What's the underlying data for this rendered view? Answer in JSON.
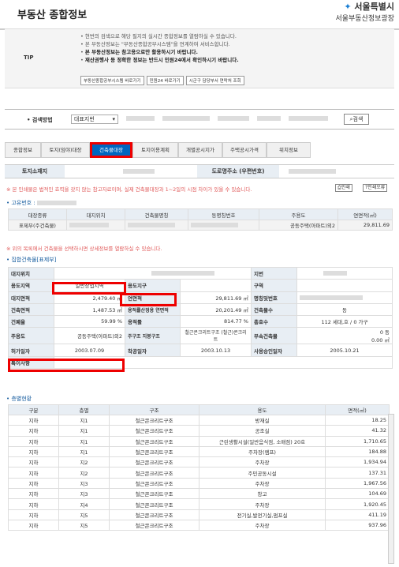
{
  "header": {
    "title": "부동산 종합정보",
    "logo_line1": "서울특별시",
    "logo_line2": "서울부동산정보광장"
  },
  "tip": {
    "label": "TIP",
    "lines": [
      "현번의 검색으로 해당 필지의 실시간 종합정보를 열람하실 수 있습니다.",
      "본 부동산정보는 \"부동산종합공부시스템\"을 연계하여 서비스합니다.",
      "본 부동산정보는 참고용으로만 활용하시기 바랍니다.",
      "재산권행사 등 정확한 정보는 반드시 민원24에서 확인하시기 바랍니다."
    ],
    "buttons": [
      "부동산종합공부시스템 바로가기",
      "민원24 바로가기",
      "시군구 담당부서 연락처 조회"
    ]
  },
  "search": {
    "label": "검색방법",
    "select_value": "대표지번",
    "button": "검색"
  },
  "tabs": [
    "종합정보",
    "토지(임야)대장",
    "건축물대장",
    "토지이용계획",
    "개별공시지가",
    "주택공시가격",
    "위치정보"
  ],
  "location": {
    "land_label": "토지소재지",
    "road_label": "도로명주소 (우편번호)"
  },
  "notice1": "※ 본 인쇄물은 법적인 효력을 갖지 않는 참고자료이며, 실제 건축물대장과 1~2일의 시점 차이가 있을 수 있습니다.",
  "print_btn": "인쇄",
  "print_err_btn": "인쇄오류",
  "unique_no_label": "고유번호 :",
  "building_list": {
    "headers": [
      "대장종류",
      "대지위치",
      "건축물명칭",
      "동명칭번호",
      "주용도",
      "연면적(㎡)"
    ],
    "row": {
      "type": "표제부(주건축물)",
      "use": "공동주택(아파트)외2",
      "area": "29,811.69"
    }
  },
  "notice2": "※ 위의 목록에서 건축물을 선택하시면 상세정보를 열람하실 수 있습니다.",
  "detail_title": "집합건축물[표제부]",
  "detail": {
    "site": "대지위치",
    "lot": "지번",
    "zone_label": "용도지역",
    "zone": "일반상업지역",
    "district_label": "용도지구",
    "area_label": "구역",
    "land_area_label": "대지면적",
    "land_area": "2,479.40 ㎡",
    "total_area_label": "연면적",
    "total_area": "29,811.69 ㎡",
    "name_label": "명칭및번호",
    "build_area_label": "건축면적",
    "build_area": "1,487.53 ㎡",
    "floor_ratio_area_label": "용적률산정용 연면적",
    "floor_ratio_area": "20,201.49 ㎡",
    "bldg_count_label": "건축물수",
    "bldg_count": "동",
    "coverage_label": "건폐율",
    "coverage": "59.99 %",
    "floor_ratio_label": "용적률",
    "floor_ratio": "814.77 %",
    "households_label": "총호수",
    "households": "112 세대,호 / 0 가구",
    "main_use_label": "주용도",
    "main_use": "공동주택(아파트)외2",
    "structure_label": "주구조 지붕구조",
    "structure": "철근콘크리트구조 (철근)콘크리트",
    "annex_label": "부속건축물",
    "annex_count": "0 동",
    "annex_area": "0.00 ㎡",
    "permit_label": "허가일자",
    "permit": "2003.07.09",
    "start_label": "착공일자",
    "start": "2003.10.13",
    "approval_label": "사용승인일자",
    "approval": "2005.10.21",
    "special_label": "특이사항"
  },
  "floor_title": "층별현황",
  "floors": {
    "headers": [
      "구분",
      "층별",
      "구조",
      "용도",
      "면적(㎡)"
    ],
    "rows": [
      [
        "지하",
        "지1",
        "철근콘크리트구조",
        "방재실",
        "18.25"
      ],
      [
        "지하",
        "지1",
        "철근콘크리트구조",
        "공조실",
        "41.32"
      ],
      [
        "지하",
        "지1",
        "철근콘크리트구조",
        "근린생활시설(일반음식점, 소매점) 20호",
        "1,710.65"
      ],
      [
        "지하",
        "지1",
        "철근콘크리트구조",
        "주차장(램프)",
        "184.88"
      ],
      [
        "지하",
        "지2",
        "철근콘크리트구조",
        "주차장",
        "1,934.94"
      ],
      [
        "지하",
        "지2",
        "철근콘크리트구조",
        "주민공동시설",
        "137.31"
      ],
      [
        "지하",
        "지3",
        "철근콘크리트구조",
        "주차장",
        "1,967.56"
      ],
      [
        "지하",
        "지3",
        "철근콘크리트구조",
        "창고",
        "104.69"
      ],
      [
        "지하",
        "지4",
        "철근콘크리트구조",
        "주차장",
        "1,920.45"
      ],
      [
        "지하",
        "지5",
        "철근콘크리트구조",
        "전기실,발전기실,펌프실",
        "411.19"
      ],
      [
        "지하",
        "지5",
        "철근콘크리트구조",
        "주차장",
        "937.96"
      ]
    ]
  }
}
